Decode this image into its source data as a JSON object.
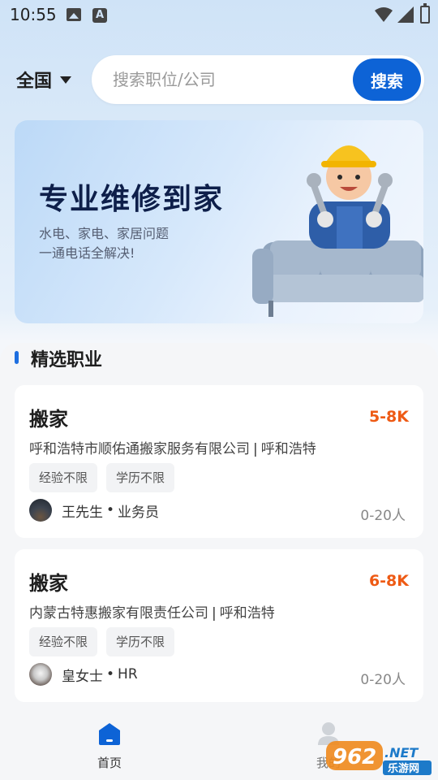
{
  "status_bar": {
    "time": "10:55",
    "icons": [
      "image-icon",
      "a-icon",
      "wifi-icon",
      "signal-icon",
      "battery-icon"
    ]
  },
  "header": {
    "region": "全国",
    "search_placeholder": "搜索职位/公司",
    "search_button": "搜索"
  },
  "banner": {
    "title": "专业维修到家",
    "subtitle_line1": "水电、家电、家居问题",
    "subtitle_line2": "一通电话全解决!"
  },
  "section": {
    "title": "精选职业"
  },
  "jobs": [
    {
      "title": "搬家",
      "salary": "5-8K",
      "company": "呼和浩特市顺佑通搬家服务有限公司",
      "city": "呼和浩特",
      "tags": [
        "经验不限",
        "学历不限"
      ],
      "recruiter_name": "王先生",
      "recruiter_role": "业务员",
      "company_size": "0-20人"
    },
    {
      "title": "搬家",
      "salary": "6-8K",
      "company": "内蒙古特惠搬家有限责任公司",
      "city": "呼和浩特",
      "tags": [
        "经验不限",
        "学历不限"
      ],
      "recruiter_name": "皇女士",
      "recruiter_role": "HR",
      "company_size": "0-20人"
    }
  ],
  "bottom_nav": {
    "home_label": "首页",
    "me_label": "我的"
  },
  "watermark": {
    "text1": "962",
    "text2": ".NET",
    "text3": "乐游网"
  },
  "colors": {
    "accent": "#0d63d6",
    "salary": "#ee5a14",
    "section_marker": "#1e6fe0"
  }
}
